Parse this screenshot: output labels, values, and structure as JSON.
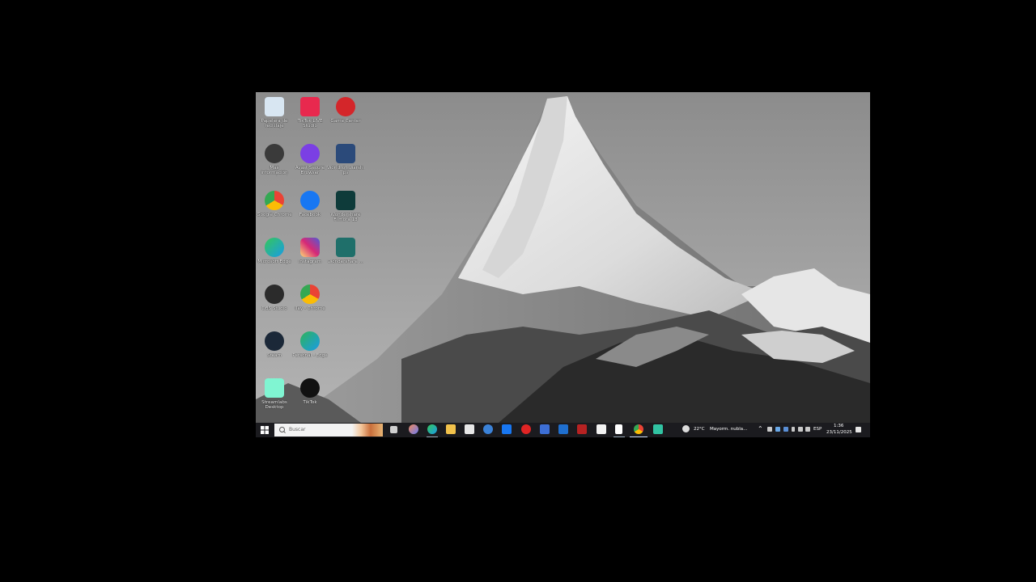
{
  "desktop": {
    "icons": [
      {
        "label": "Papelera de reciclaje",
        "icon": "recycle-bin-icon",
        "color": "#d8e6f2"
      },
      {
        "label": "TikTok LIVE Studio",
        "icon": "tiktok-live-studio-icon",
        "color": "#e8294e"
      },
      {
        "label": "Game Center",
        "icon": "game-center-icon",
        "color": "#d4262a"
      },
      {
        "label": "Más información acerca de esta imagen",
        "icon": "spotlight-info-icon",
        "color": "#3a3a3a"
      },
      {
        "label": "Avast Secure Browser",
        "icon": "avast-browser-icon",
        "color": "#7b3fe4"
      },
      {
        "label": "World_of_Warships",
        "icon": "world-of-warships-icon",
        "color": "#2b4a7a"
      },
      {
        "label": "Google Chrome",
        "icon": "chrome-icon",
        "color": "#4285f4"
      },
      {
        "label": "Facebook",
        "icon": "facebook-icon",
        "color": "#1877f2"
      },
      {
        "label": "Wondershare Filmora 13",
        "icon": "filmora-icon",
        "color": "#0e3b3a"
      },
      {
        "label": "Microsoft Edge",
        "icon": "edge-icon",
        "color": "#1a9be6"
      },
      {
        "label": "Instagram",
        "icon": "instagram-icon",
        "color": "#d62976"
      },
      {
        "label": "Wondershare ...",
        "icon": "wondershare-icon",
        "color": "#1f6f6a"
      },
      {
        "label": "OBS Studio",
        "icon": "obs-studio-icon",
        "color": "#2b2b2b"
      },
      {
        "label": "Iley - Chrome",
        "icon": "chrome-profile-icon",
        "color": "#ea4335"
      },
      {
        "label": "Steam",
        "icon": "steam-icon",
        "color": "#1b2838"
      },
      {
        "label": "Personal - Edge",
        "icon": "edge-profile-icon",
        "color": "#2fb35a"
      },
      {
        "label": "Streamlabs Desktop",
        "icon": "streamlabs-icon",
        "color": "#80f5d2"
      },
      {
        "label": "TikTok",
        "icon": "tiktok-icon",
        "color": "#111111"
      }
    ]
  },
  "taskbar": {
    "search_placeholder": "Buscar",
    "apps": [
      {
        "icon": "task-view-icon",
        "color": "#cfcfcf"
      },
      {
        "icon": "copilot-icon",
        "color": "#6c7bf0"
      },
      {
        "icon": "edge-icon",
        "color": "#1a9be6"
      },
      {
        "icon": "file-explorer-icon",
        "color": "#f2c24b"
      },
      {
        "icon": "microsoft-store-icon",
        "color": "#e8e8e8"
      },
      {
        "icon": "mail-icon",
        "color": "#3b82d8"
      },
      {
        "icon": "facebook-icon",
        "color": "#1877f2"
      },
      {
        "icon": "youtube-icon",
        "color": "#e02424"
      },
      {
        "icon": "app-icon",
        "color": "#3d6fd6"
      },
      {
        "icon": "outlook-icon",
        "color": "#1f6fcf"
      },
      {
        "icon": "app-red-icon",
        "color": "#b72222"
      },
      {
        "icon": "amazon-icon",
        "color": "#f2f2f2"
      },
      {
        "icon": "document-icon",
        "color": "#ffffff"
      },
      {
        "icon": "chrome-icon",
        "color": "#4285f4"
      },
      {
        "icon": "streamlabs-icon",
        "color": "#31c3a2"
      }
    ],
    "weather_temp": "22°C",
    "weather_desc": "Mayorm. nubla...",
    "language": "ESP",
    "time": "1:36",
    "date": "23/11/2025"
  }
}
